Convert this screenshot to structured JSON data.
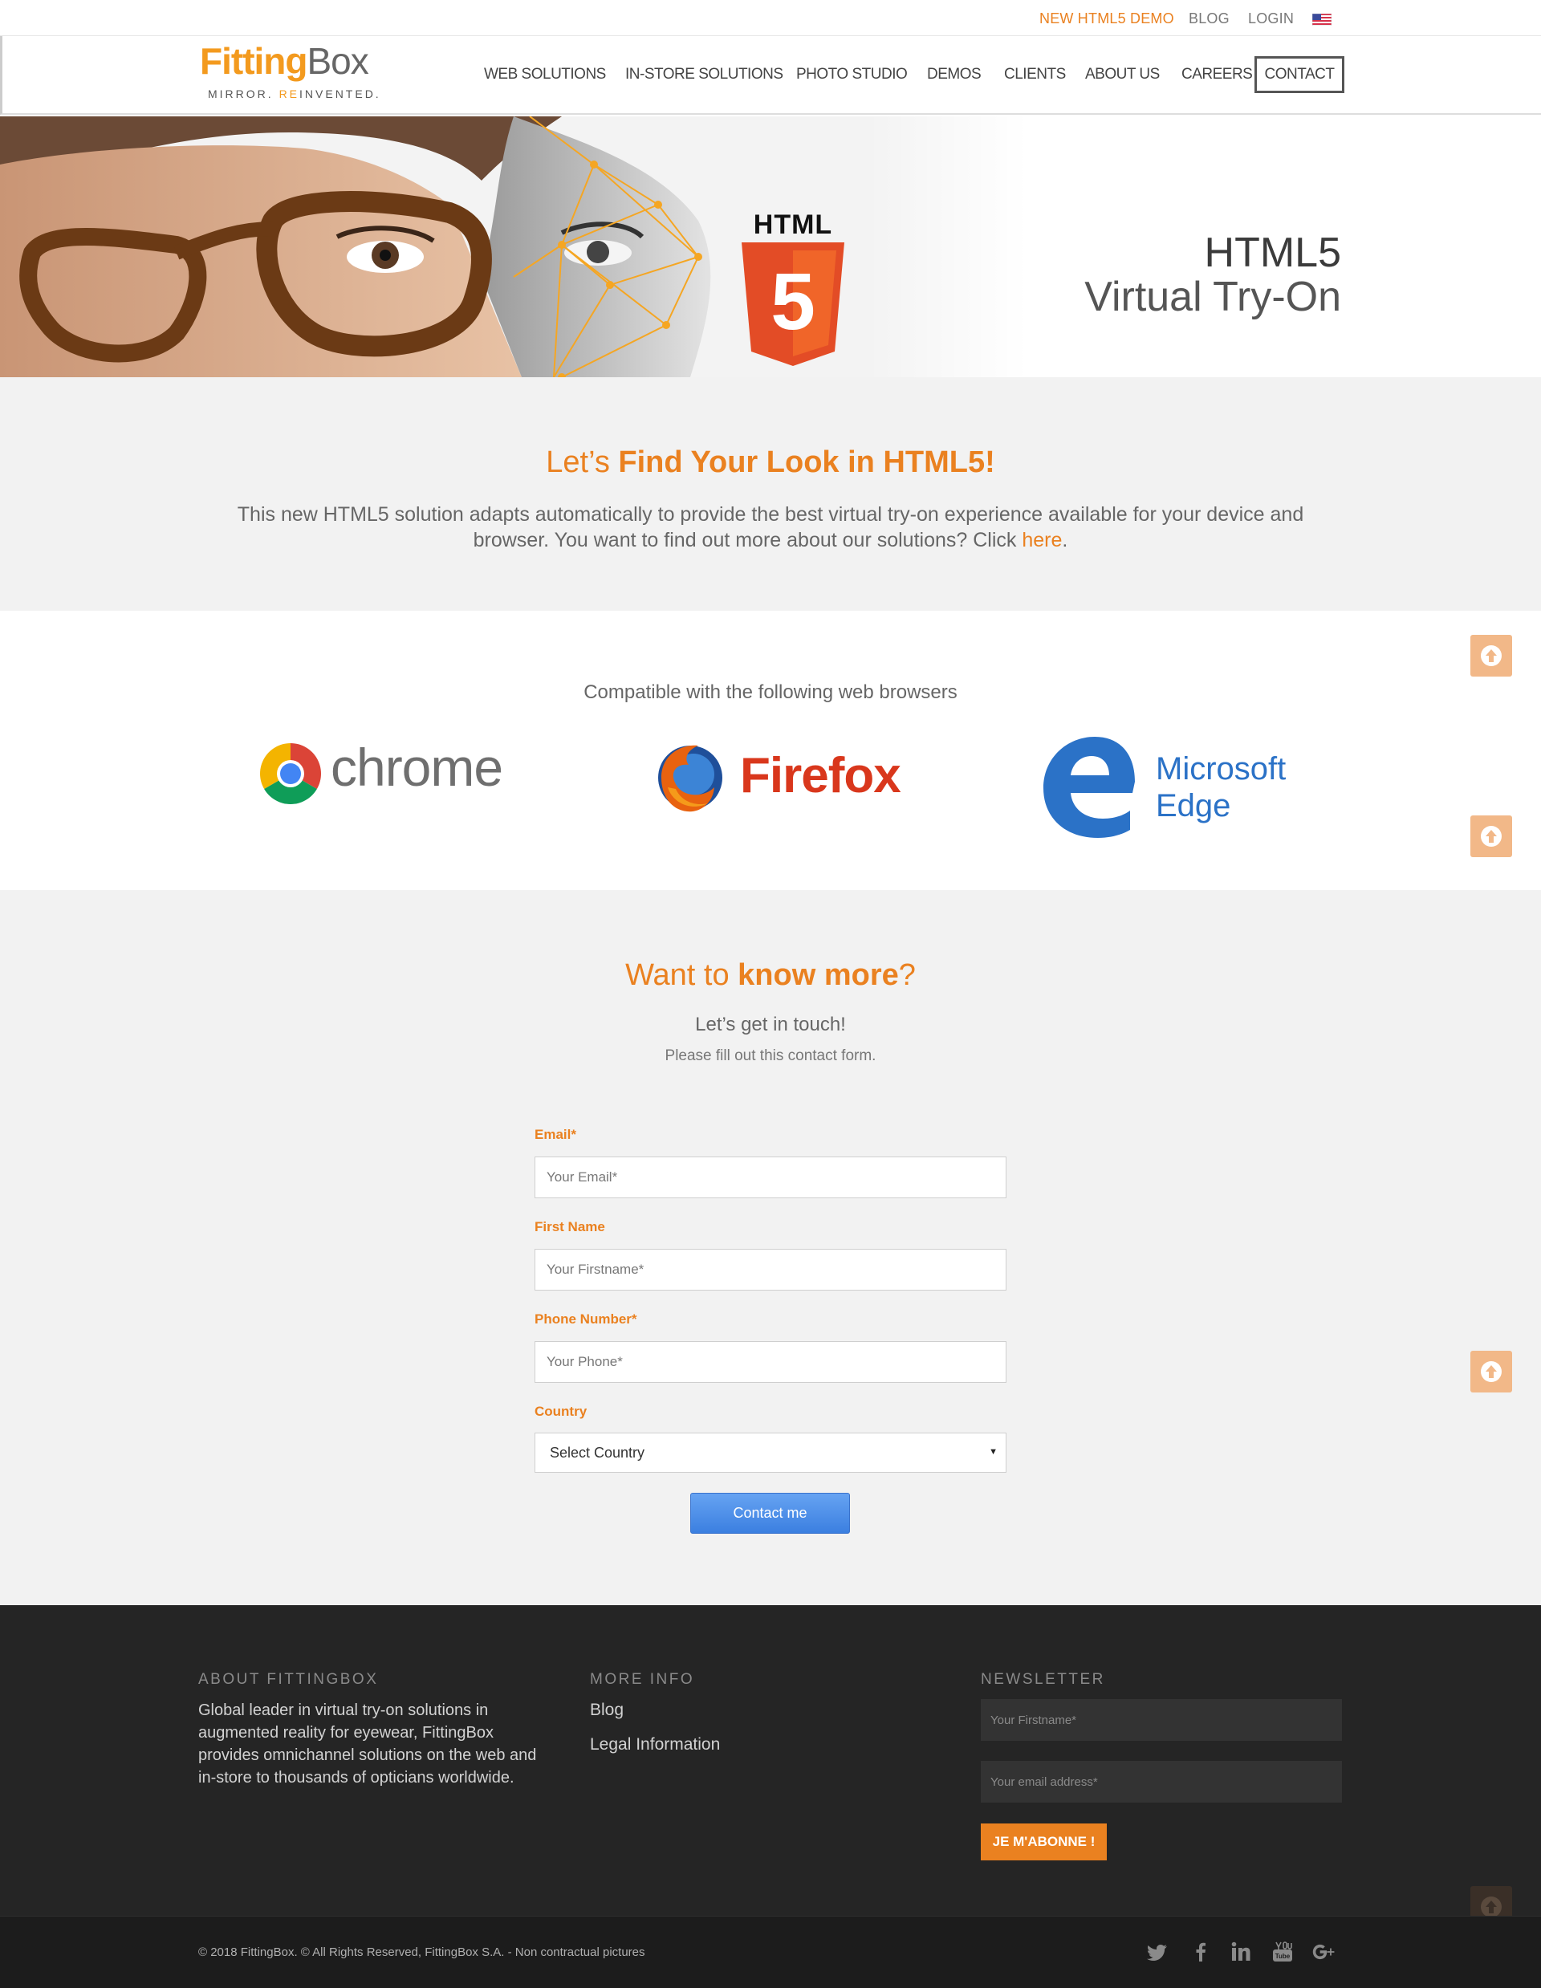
{
  "colors": {
    "accent": "#ea8120",
    "logo_orange": "#f39a1e",
    "footer_bg": "#252525",
    "button_blue": "#4a8de8"
  },
  "topbar": {
    "links": [
      {
        "label": "NEW HTML5 DEMO"
      },
      {
        "label": "BLOG"
      },
      {
        "label": "LOGIN"
      }
    ],
    "flag_icon": "us-flag-icon"
  },
  "logo": {
    "part1": "Fitting",
    "part2": "Box",
    "tagline_a": "MIRROR. ",
    "tagline_re": "RE",
    "tagline_b": "INVENTED."
  },
  "nav": {
    "items": [
      {
        "label": "WEB SOLUTIONS"
      },
      {
        "label": "IN-STORE SOLUTIONS"
      },
      {
        "label": "PHOTO STUDIO"
      },
      {
        "label": "DEMOS"
      },
      {
        "label": "CLIENTS"
      },
      {
        "label": "ABOUT US"
      },
      {
        "label": "CAREERS"
      }
    ],
    "contact": "CONTACT"
  },
  "hero": {
    "html_badge": "HTML",
    "html_number": "5",
    "title_line1": "HTML5",
    "title_line2": "Virtual Try-On"
  },
  "intro": {
    "heading_a": "Let’s ",
    "heading_b": "Find Your Look in HTML5!",
    "text_a": "This new HTML5 solution adapts automatically to provide the best virtual try-on experience available for your device and browser. You want to find out more about our solutions? Click ",
    "link": "here",
    "text_b": "."
  },
  "browsers": {
    "title": "Compatible with the following web browsers",
    "chrome": "chrome",
    "firefox": "Firefox",
    "edge_a": "Microsoft",
    "edge_b": "Edge"
  },
  "form": {
    "heading_a": "Want to ",
    "heading_b": "know more",
    "heading_c": "?",
    "subheading": "Let’s get in touch!",
    "instruction": "Please fill out this contact form.",
    "fields": [
      {
        "label": "Email*",
        "placeholder": "Your Email*"
      },
      {
        "label": "First Name",
        "placeholder": "Your Firstname*"
      },
      {
        "label": "Phone Number*",
        "placeholder": "Your Phone*"
      },
      {
        "label": "Country"
      }
    ],
    "country_value": "Select Country",
    "submit": "Contact me"
  },
  "footer": {
    "about_heading": "ABOUT FITTINGBOX",
    "about_text": "Global leader in virtual try-on solutions in augmented reality for eyewear, FittingBox provides omnichannel solutions on the web and in-store to thousands of opticians worldwide.",
    "more_heading": "MORE INFO",
    "more_links": [
      {
        "label": "Blog"
      },
      {
        "label": "Legal Information"
      }
    ],
    "newsletter_heading": "NEWSLETTER",
    "nl_firstname_placeholder": "Your Firstname*",
    "nl_email_placeholder": "Your email address*",
    "nl_button": "JE M'ABONNE !",
    "copyright": "© 2018 FittingBox. © All Rights Reserved, FittingBox S.A. - Non contractual pictures",
    "social_icons": [
      "twitter-icon",
      "facebook-icon",
      "linkedin-icon",
      "youtube-icon",
      "google-plus-icon"
    ]
  }
}
